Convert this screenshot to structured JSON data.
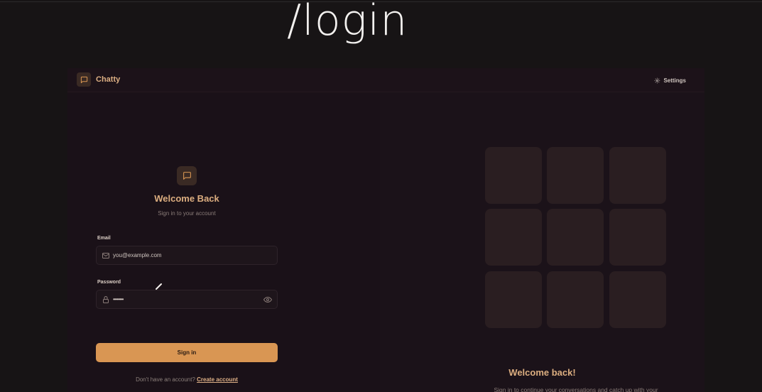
{
  "overlay": {
    "route_text": "/login"
  },
  "header": {
    "brand": "Chatty",
    "settings_label": "Settings"
  },
  "login": {
    "title": "Welcome Back",
    "subtitle": "Sign in to your account",
    "email_label": "Email",
    "email_placeholder": "you@example.com",
    "password_label": "Password",
    "password_mask": "••••••••",
    "submit_label": "Sign in",
    "signup_prompt": "Don't have an account?",
    "signup_link": "Create account"
  },
  "promo": {
    "title": "Welcome back!",
    "subtitle": "Sign in to continue your conversations and catch up with your messages."
  },
  "icons": {
    "brand": "message-square-icon",
    "settings": "gear-icon",
    "email": "mail-icon",
    "password": "lock-icon",
    "reveal": "eye-icon"
  },
  "colors": {
    "accent": "#d99653",
    "heading": "#dcae80",
    "background": "#1a1118"
  }
}
